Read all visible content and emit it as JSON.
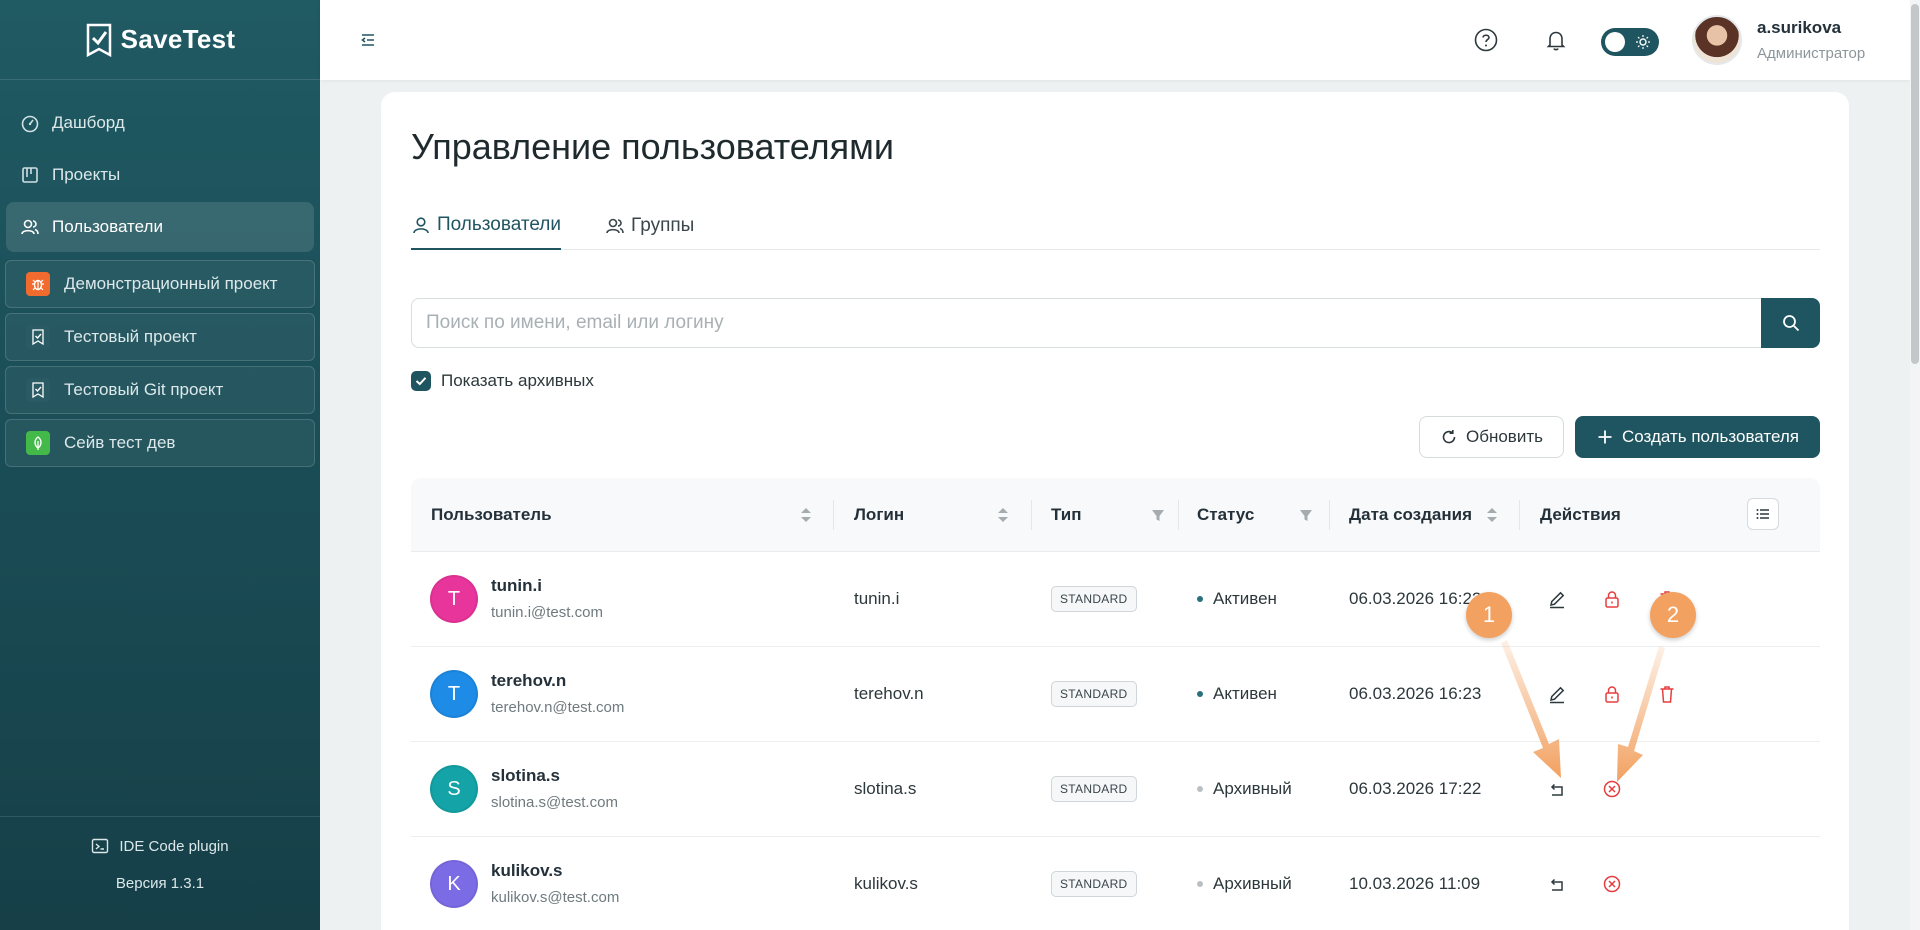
{
  "app": {
    "name": "SaveTest"
  },
  "sidebar": {
    "nav": [
      {
        "label": "Дашборд",
        "icon": "dashboard-icon"
      },
      {
        "label": "Проекты",
        "icon": "projects-icon"
      },
      {
        "label": "Пользователи",
        "icon": "users-icon",
        "active": true
      }
    ],
    "projects": [
      {
        "label": "Демонстрационный проект",
        "icon": "bug-icon",
        "color": "#f26b2e"
      },
      {
        "label": "Тестовый проект",
        "icon": "checklist-icon",
        "color": "#2a5b64"
      },
      {
        "label": "Тестовый Git проект",
        "icon": "checklist-icon",
        "color": "#2a5b64"
      },
      {
        "label": "Сейв тест дев",
        "icon": "leaf-icon",
        "color": "#43b94a"
      }
    ],
    "plugin_label": "IDE Code plugin",
    "version": "Версия 1.3.1"
  },
  "header": {
    "user_name": "a.surikova",
    "user_role": "Администратор"
  },
  "page": {
    "title": "Управление пользователями",
    "tabs": [
      {
        "label": "Пользователи",
        "active": true
      },
      {
        "label": "Группы"
      }
    ],
    "search_placeholder": "Поиск по имени, email или логину",
    "show_archived_label": "Показать архивных",
    "show_archived": true,
    "refresh_label": "Обновить",
    "create_label": "Создать пользователя"
  },
  "table": {
    "columns": [
      "Пользователь",
      "Логин",
      "Тип",
      "Статус",
      "Дата создания",
      "Действия"
    ],
    "rows": [
      {
        "initial": "T",
        "name": "tunin.i",
        "email": "tunin.i@test.com",
        "login": "tunin.i",
        "type": "STANDARD",
        "status": "Активен",
        "date": "06.03.2026 16:22",
        "avatar_color": "#e8359b",
        "archived": false
      },
      {
        "initial": "T",
        "name": "terehov.n",
        "email": "terehov.n@test.com",
        "login": "terehov.n",
        "type": "STANDARD",
        "status": "Активен",
        "date": "06.03.2026 16:23",
        "avatar_color": "#1e8be6",
        "archived": false
      },
      {
        "initial": "S",
        "name": "slotina.s",
        "email": "slotina.s@test.com",
        "login": "slotina.s",
        "type": "STANDARD",
        "status": "Архивный",
        "date": "06.03.2026 17:22",
        "avatar_color": "#14a3a6",
        "archived": true
      },
      {
        "initial": "K",
        "name": "kulikov.s",
        "email": "kulikov.s@test.com",
        "login": "kulikov.s",
        "type": "STANDARD",
        "status": "Архивный",
        "date": "10.03.2026 11:09",
        "avatar_color": "#7b6ce6",
        "archived": true
      }
    ]
  },
  "annotations": [
    {
      "label": "1"
    },
    {
      "label": "2"
    }
  ],
  "colors": {
    "primary": "#1f5560",
    "danger": "#e53e3e",
    "active_dot": "#2a6f7c",
    "archived_dot": "#b9bfc3",
    "annotation": "#f2a160"
  }
}
